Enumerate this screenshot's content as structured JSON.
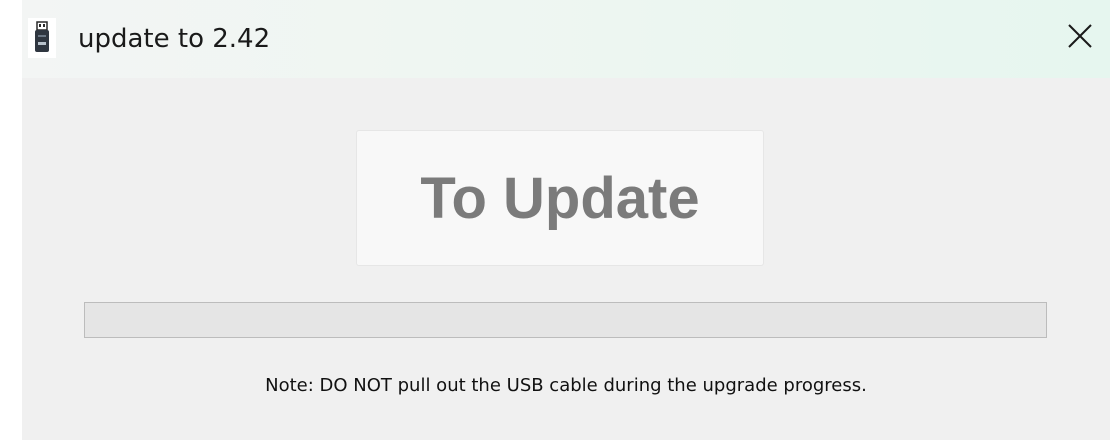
{
  "window": {
    "title": "update to 2.42",
    "app_icon": "usb-drive-icon",
    "close_icon": "close-icon"
  },
  "main": {
    "update_button_label": "To Update",
    "progress": {
      "value_percent": 0
    },
    "note": "Note: DO NOT pull out the USB cable during the upgrade progress."
  },
  "colors": {
    "window_background": "#f0f0f0",
    "button_text": "#7b7b7b",
    "progress_track": "#e5e5e5",
    "progress_border": "#bcbcbc"
  }
}
